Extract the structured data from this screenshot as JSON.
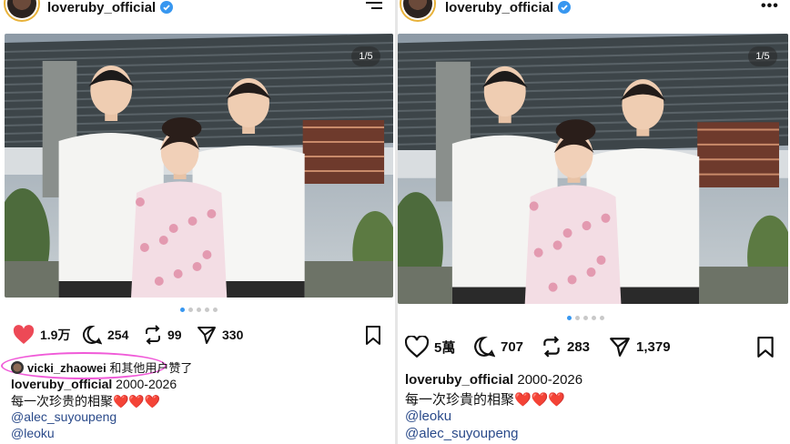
{
  "left": {
    "username": "loveruby_official",
    "photo_counter": "1/5",
    "pager": {
      "count": 5,
      "active": 0
    },
    "likes": "1.9万",
    "comments": "254",
    "reposts": "99",
    "shares": "330",
    "liked_by": {
      "user": "vicki_zhaowei",
      "rest": "和其他用户赞了"
    },
    "caption": {
      "user": "loveruby_official",
      "text": "2000-2026"
    },
    "caption_line2": "每一次珍贵的相聚",
    "hearts": "❤️❤️❤️",
    "mentions": [
      "@alec_suyoupeng",
      "@leoku"
    ]
  },
  "right": {
    "username": "loveruby_official",
    "photo_counter": "1/5",
    "pager": {
      "count": 5,
      "active": 0
    },
    "likes": "5萬",
    "comments": "707",
    "reposts": "283",
    "shares": "1,379",
    "caption": {
      "user": "loveruby_official",
      "text": "2000-2026"
    },
    "caption_line2": "每一次珍貴的相聚",
    "hearts": "❤️❤️❤️",
    "mentions": [
      "@leoku",
      "@alec_suyoupeng"
    ]
  },
  "colors": {
    "like_red": "#ed4956",
    "verified_blue": "#3897f0",
    "highlight": "#f05ad8",
    "pager_active": "#3897f0"
  },
  "icons": [
    "heart-icon",
    "comment-icon",
    "repost-icon",
    "share-icon",
    "bookmark-icon",
    "verified-icon",
    "menu-icon",
    "more-icon"
  ]
}
